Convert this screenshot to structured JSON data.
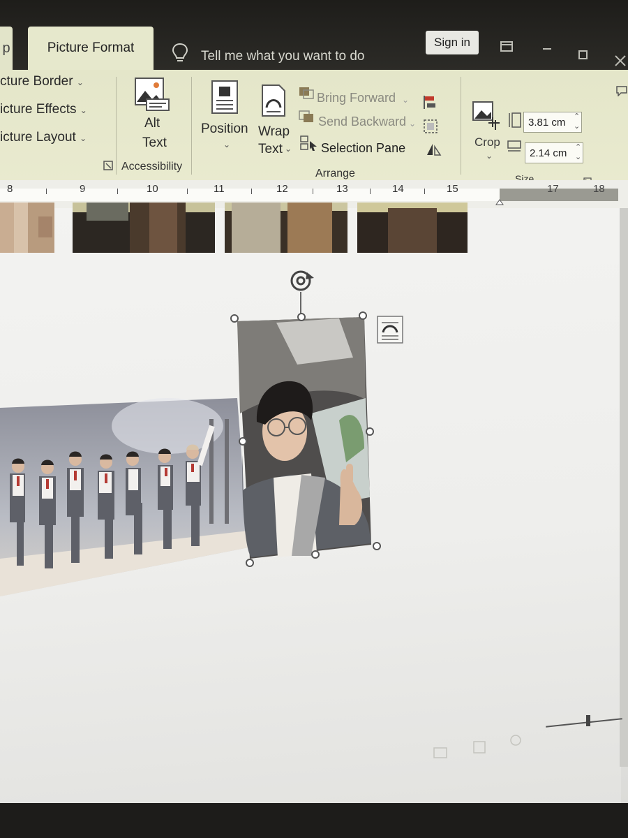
{
  "tabs": {
    "prev_fragment": "p",
    "active": "Picture Format",
    "tell_me": "Tell me what you want to do"
  },
  "account": {
    "sign_in": "Sign in"
  },
  "ribbon": {
    "picture_styles": {
      "border": "cture Border",
      "effects": "icture Effects",
      "layout": "icture Layout"
    },
    "accessibility": {
      "alt_text_line1": "Alt",
      "alt_text_line2": "Text",
      "group_label": "Accessibility"
    },
    "arrange": {
      "position": "Position",
      "wrap_line1": "Wrap",
      "wrap_line2": "Text",
      "bring_forward": "Bring Forward",
      "send_backward": "Send Backward",
      "selection_pane": "Selection Pane",
      "group_label": "Arrange"
    },
    "size": {
      "crop": "Crop",
      "height": "3.81 cm",
      "width": "2.14 cm",
      "group_label": "Size"
    }
  },
  "ruler": {
    "numbers": [
      "8",
      "9",
      "10",
      "11",
      "12",
      "13",
      "14",
      "15",
      "17",
      "18"
    ]
  },
  "colors": {
    "ribbon": "#e6e8cc",
    "titlebar": "#1e1d1a",
    "page": "#f1f1ef"
  },
  "icons": [
    "lightbulb-icon",
    "alt-text-icon",
    "position-icon",
    "wrap-text-icon",
    "crop-icon",
    "rotate-handle-icon",
    "layout-options-icon"
  ]
}
